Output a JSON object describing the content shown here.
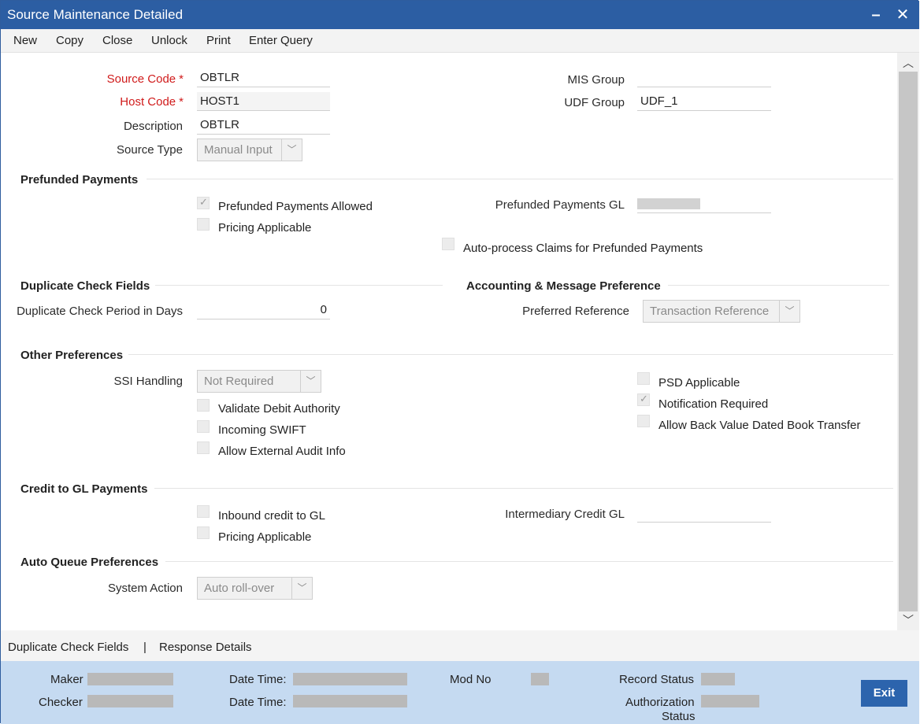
{
  "window": {
    "title": "Source Maintenance Detailed",
    "minimize": "–",
    "close": "✕"
  },
  "menu": [
    "New",
    "Copy",
    "Close",
    "Unlock",
    "Print",
    "Enter Query"
  ],
  "header": {
    "source_code": {
      "label": "Source Code",
      "required_mark": "*",
      "value": "OBTLR"
    },
    "host_code": {
      "label": "Host Code",
      "required_mark": "*",
      "value": "HOST1"
    },
    "description": {
      "label": "Description",
      "value": "OBTLR"
    },
    "source_type": {
      "label": "Source Type",
      "value": "Manual Input"
    },
    "mis_group": {
      "label": "MIS Group",
      "value": ""
    },
    "udf_group": {
      "label": "UDF Group",
      "value": "UDF_1"
    }
  },
  "prefunded": {
    "title": "Prefunded Payments",
    "allowed": {
      "label": "Prefunded Payments Allowed",
      "checked": true
    },
    "pricing": {
      "label": "Pricing Applicable",
      "checked": false
    },
    "gl": {
      "label": "Prefunded Payments GL"
    },
    "auto_process": {
      "label": "Auto-process Claims for Prefunded Payments",
      "checked": false
    }
  },
  "duplicate": {
    "title": "Duplicate Check Fields",
    "period_label": "Duplicate Check Period in Days",
    "period_value": "0"
  },
  "accounting": {
    "title": "Accounting & Message Preference",
    "preferred_label": "Preferred Reference",
    "preferred_value": "Transaction Reference"
  },
  "other": {
    "title": "Other Preferences",
    "ssi_label": "SSI Handling",
    "ssi_value": "Not Required",
    "validate_debit": {
      "label": "Validate Debit Authority",
      "checked": false
    },
    "incoming_swift": {
      "label": "Incoming SWIFT",
      "checked": false
    },
    "external_audit": {
      "label": "Allow External Audit Info",
      "checked": false
    },
    "psd": {
      "label": "PSD Applicable",
      "checked": false
    },
    "notification": {
      "label": "Notification Required",
      "checked": true
    },
    "back_value": {
      "label": "Allow Back Value Dated Book Transfer",
      "checked": false
    }
  },
  "credit_gl": {
    "title": "Credit to GL Payments",
    "inbound": {
      "label": "Inbound credit to GL",
      "checked": false
    },
    "pricing": {
      "label": "Pricing Applicable",
      "checked": false
    },
    "intermediary_label": "Intermediary Credit GL",
    "intermediary_value": ""
  },
  "auto_queue": {
    "title": "Auto Queue Preferences",
    "system_action_label": "System Action",
    "system_action_value": "Auto roll-over"
  },
  "footer_links": {
    "duplicate": "Duplicate Check Fields",
    "separator": "|",
    "response": "Response Details"
  },
  "status": {
    "maker": "Maker",
    "checker": "Checker",
    "date_time_1": "Date Time:",
    "date_time_2": "Date Time:",
    "mod_no": "Mod No",
    "record_status": "Record Status",
    "authorization": "Authorization",
    "authorization_status": "Status",
    "exit": "Exit"
  },
  "icons": {
    "minimize": "minimize-icon",
    "close": "close-icon",
    "dropdown": "chevron-down-icon",
    "scroll_up": "chevron-up-icon",
    "scroll_down": "chevron-down-icon",
    "check": "check-icon"
  },
  "colors": {
    "titlebar": "#2c5ea3",
    "required": "#d01b1b",
    "statusbar": "#c5daf1",
    "exit_button": "#2c64ad"
  }
}
